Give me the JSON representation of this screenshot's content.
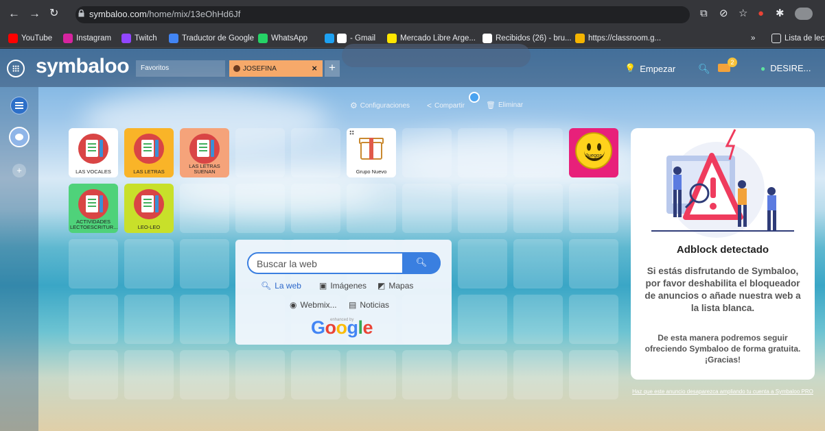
{
  "browser": {
    "url_host": "symbaloo.com",
    "url_path": "/home/mix/13eOhHd6Jf",
    "bookmarks": [
      {
        "label": "YouTube",
        "color": "#ff0000",
        "icon": "youtube-icon"
      },
      {
        "label": "Instagram",
        "color": "#d6249f",
        "icon": "instagram-icon"
      },
      {
        "label": "Twitch",
        "color": "#9146ff",
        "icon": "twitch-icon"
      },
      {
        "label": "Traductor de Google",
        "color": "#4285f4",
        "icon": "translate-icon"
      },
      {
        "label": "WhatsApp",
        "color": "#25d366",
        "icon": "whatsapp-icon"
      },
      {
        "label": "",
        "color": "#1da1f2",
        "icon": "twitter-icon"
      },
      {
        "label": "- Gmail",
        "color": "#ffffff",
        "icon": "google-icon"
      },
      {
        "label": "Mercado Libre Arge...",
        "color": "#ffe600",
        "icon": "mercadolibre-icon"
      },
      {
        "label": "Recibidos (26) - bru...",
        "color": "#ffffff",
        "icon": "google-icon"
      },
      {
        "label": "https://classroom.g...",
        "color": "#f4b400",
        "icon": "classroom-icon"
      }
    ],
    "more_bookmarks": "»",
    "reading_list": "Lista de lect"
  },
  "header": {
    "logo": "symbaloo",
    "tabs": [
      {
        "label": "Favoritos"
      },
      {
        "label": "JOSEFINA",
        "active": true
      }
    ],
    "tab_close": "×",
    "add_tab": "+",
    "empezar": "Empezar",
    "mail_count": "2",
    "user": "DESIRE..."
  },
  "toolbar": {
    "settings": "Configuraciones",
    "share": "Compartir",
    "delete": "Eliminar"
  },
  "sidebar": {
    "add": "+"
  },
  "tiles": [
    {
      "label": "LAS VOCALES",
      "bg": "#ffffff"
    },
    {
      "label": "LAS LETRAS",
      "bg": "#f9b428"
    },
    {
      "label": "LAS LETRAS SUENAN",
      "bg": "#f5a37a"
    },
    {
      "label": "Grupo Nuevo",
      "bg": "#ffffff"
    },
    {
      "label": "Juegos",
      "bg": "#e8207a"
    },
    {
      "label": "ACTIVIDADES LECTOESCRITUR...",
      "bg": "#4fd27a"
    },
    {
      "label": "LEO-LEO",
      "bg": "#c8e02a"
    }
  ],
  "search": {
    "placeholder": "Buscar la web",
    "options": [
      "La web",
      "Imágenes",
      "Mapas",
      "Webmix...",
      "Noticias"
    ],
    "enhanced_by": "enhanced by",
    "brand": "Google"
  },
  "adblock": {
    "title": "Adblock detectado",
    "message": "Si estás disfrutando de Symbaloo, por favor deshabilita el bloqueador de anuncios o añade nuestra web a la lista blanca.",
    "message2": "De esta manera podremos seguir ofreciendo Symbaloo de forma gratuita. ¡Gracias!",
    "link": "Haz que este anuncio desaparezca ampliando tu cuenta a Symbaloo PRO"
  }
}
